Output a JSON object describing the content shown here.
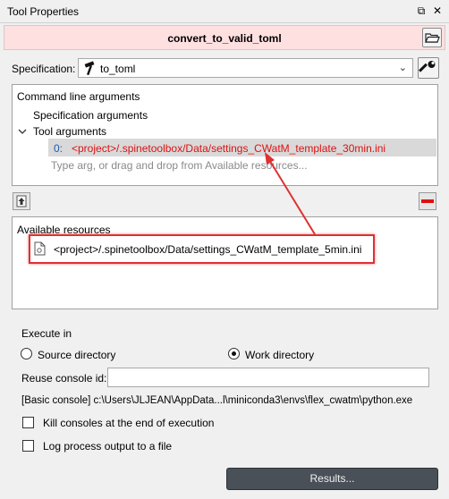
{
  "window": {
    "title": "Tool Properties",
    "float_glyph": "⧉",
    "close_glyph": "✕"
  },
  "header": {
    "item_name": "convert_to_valid_toml"
  },
  "specification": {
    "label": "Specification:",
    "value": "to_toml"
  },
  "tree": {
    "root": "Command line arguments",
    "spec_args": "Specification arguments",
    "tool_args": "Tool arguments",
    "arg_index": "0:",
    "arg_value": "<project>/.spinetoolbox/Data/settings_CWatM_template_30min.ini",
    "placeholder": "Type arg, or drag and drop from Available resources..."
  },
  "resources": {
    "title": "Available resources",
    "items": [
      "<project>/.spinetoolbox/Data/settings_CWatM_template_5min.ini"
    ]
  },
  "execute": {
    "label": "Execute in",
    "source_dir": "Source directory",
    "work_dir": "Work directory",
    "selected": "work"
  },
  "reuse": {
    "label": "Reuse console id:",
    "value": ""
  },
  "console_info": "[Basic console] c:\\Users\\JLJEAN\\AppData...l\\miniconda3\\envs\\flex_cwatm\\python.exe",
  "options": {
    "kill_consoles": "Kill consoles at the end of execution",
    "log_output": "Log process output to a file"
  },
  "results_button": "Results...",
  "colors": {
    "header_bg": "#ffe0e0",
    "arg_text": "#e01010",
    "annotation": "#e03030",
    "results_bg": "#4a5058"
  }
}
